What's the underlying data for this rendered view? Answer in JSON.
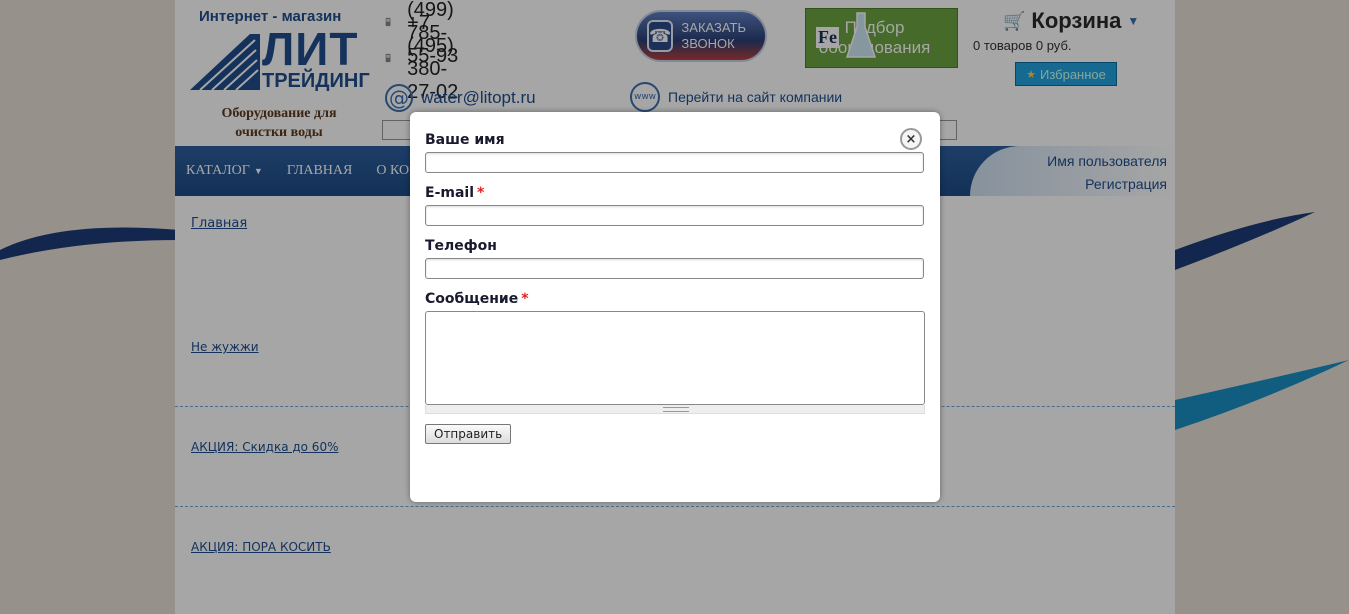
{
  "header": {
    "shop_label": "Интернет - магазин",
    "logo_lit": "ЛИТ",
    "logo_trading": "ТРЕЙДИНГ",
    "tagline": "Оборудование для очистки воды",
    "phone1": "+7 (499) 785-55-93",
    "phone2": "+7 (495) 380-27-02",
    "email": "water@litopt.ru",
    "callback_label": "ЗАКАЗАТЬ ЗВОНОК",
    "equipment_select_label": "Подбор оборудования",
    "equipment_select_fe": "Fe",
    "website_link": "Перейти на сайт компании",
    "www_icon": "www",
    "cart": {
      "title": "Корзина",
      "items_count": "0 товаров",
      "total": "0 руб.",
      "favorites_label": "Избранное"
    }
  },
  "nav": {
    "items": [
      {
        "label": "КАТАЛОГ",
        "has_dropdown": true
      },
      {
        "label": "ГЛАВНАЯ"
      },
      {
        "label": "О КО"
      }
    ],
    "username_link": "Имя пользователя",
    "register_link": "Регистрация"
  },
  "content": {
    "breadcrumb": "Главная",
    "news": [
      "Не жужжи",
      "АКЦИЯ: Скидка до 60%",
      "АКЦИЯ: ПОРА КОСИТЬ"
    ]
  },
  "modal": {
    "close_symbol": "×",
    "fields": {
      "name_label": "Ваше имя",
      "email_label": "E-mail",
      "phone_label": "Телефон",
      "message_label": "Сообщение",
      "required_mark": "*"
    },
    "submit_label": "Отправить"
  },
  "colors": {
    "brand_blue": "#1f4e8c",
    "nav_blue": "#2d5f9e",
    "required_red": "#dd2222",
    "overlay": "rgba(0,0,0,0.35)"
  }
}
